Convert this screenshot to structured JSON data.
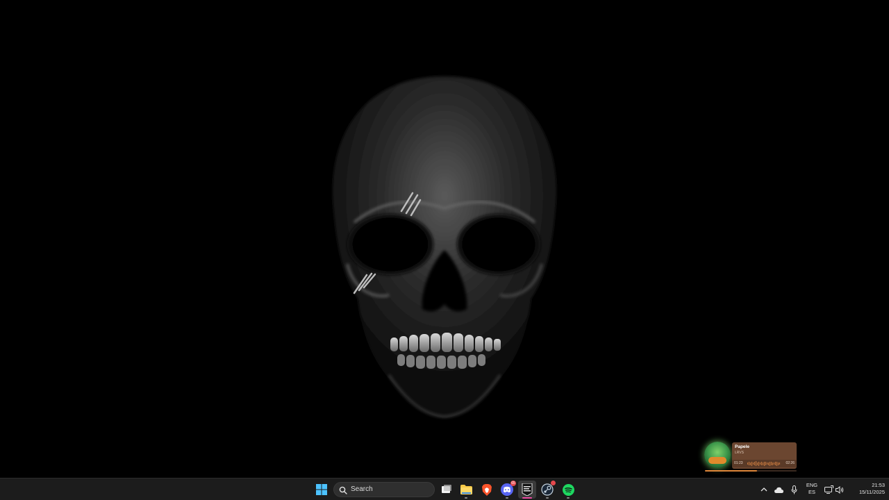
{
  "wallpaper": {
    "description_icon": "skull-icon",
    "background": "#000000"
  },
  "media_widget": {
    "title": "Papele",
    "artist": "LRVS",
    "elapsed": "01:23",
    "total": "02:26",
    "progress": 0.57,
    "card_color": "#6b4630",
    "accent": "#e0873a"
  },
  "taskbar": {
    "background": "#1c1c1c",
    "search": {
      "label": "Search"
    },
    "apps": [
      {
        "name": "start-button",
        "icon": "windows-logo-icon"
      },
      {
        "name": "task-view",
        "icon": "task-view-icon"
      },
      {
        "name": "file-explorer",
        "icon": "folder-icon"
      },
      {
        "name": "brave-browser",
        "icon": "brave-lion-icon"
      },
      {
        "name": "discord",
        "icon": "discord-icon",
        "badge": "65"
      },
      {
        "name": "epic-games",
        "icon": "epic-games-icon"
      },
      {
        "name": "steam",
        "icon": "steam-icon"
      },
      {
        "name": "spotify",
        "icon": "spotify-icon"
      }
    ],
    "tray": {
      "language_primary": "ENG",
      "language_secondary": "ES",
      "time": "21:53",
      "date": "15/11/2025"
    }
  }
}
